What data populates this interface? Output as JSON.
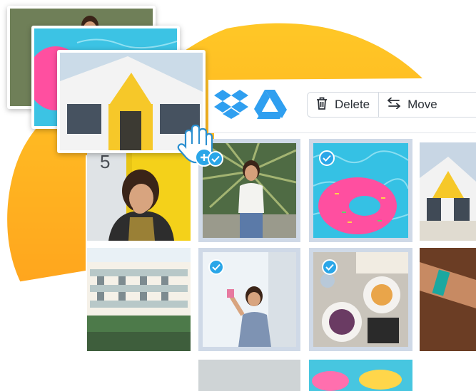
{
  "toolbar": {
    "dropbox_icon": "dropbox-icon",
    "drive_icon": "google-drive-icon",
    "delete_label": "Delete",
    "move_label": "Move",
    "delete_icon": "trash-icon",
    "move_icon": "swap-arrows-icon"
  },
  "colors": {
    "accent_blue": "#2aa6e8",
    "blob_orange_top": "#ffc325",
    "blob_orange_bottom": "#ffa01f",
    "selected_tile_bg": "#cfd9e7",
    "dropbox_blue": "#2f9ff0"
  },
  "grid": {
    "tiles": [
      {
        "id": "woman-laughing-yellow-door",
        "selected": false
      },
      {
        "id": "woman-palm-leaves",
        "selected": true
      },
      {
        "id": "pink-donut-float-pool",
        "selected": true
      },
      {
        "id": "white-building-yellow-door",
        "selected": false
      },
      {
        "id": "motel-balconies",
        "selected": false
      },
      {
        "id": "woman-selfie",
        "selected": true
      },
      {
        "id": "brunch-table",
        "selected": true
      },
      {
        "id": "arm-bracelets",
        "selected": false
      }
    ],
    "door_number": "5"
  },
  "drag_stack": {
    "cards": [
      "woman-palm-photo",
      "pool-donut-photo",
      "white-building-photo"
    ],
    "cursor_icon": "hand-grab-icon",
    "add_badge_icon": "plus-icon"
  }
}
